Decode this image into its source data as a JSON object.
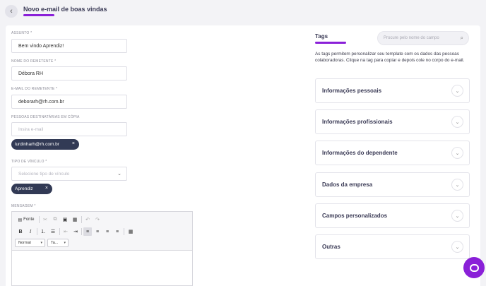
{
  "header": {
    "title": "Novo e-mail de boas vindas",
    "back_icon": "chevron-left-icon"
  },
  "form": {
    "assunto": {
      "label": "ASSUNTO *",
      "value": "Bem vindo Aprendiz!"
    },
    "nome_remetente": {
      "label": "NOME DO REMETENTE *",
      "value": "Débora RH"
    },
    "email_remetente": {
      "label": "E-MAIL DO REMETENTE *",
      "value": "deborarh@rh.com.br"
    },
    "copia": {
      "label": "PESSOAS DESTINATÁRIAS EM CÓPIA",
      "placeholder": "Insira e-mail",
      "chips": [
        "lurdinharh@rh.com.br"
      ]
    },
    "vinculo": {
      "label": "TIPO DE VÍNCULO *",
      "placeholder": "Selecione tipo de vínculo",
      "chips": [
        "Aprendiz"
      ]
    },
    "mensagem": {
      "label": "MENSAGEM *"
    }
  },
  "editor": {
    "source_label": "Fonte",
    "format_select": "Normal",
    "size_select": "Ta..."
  },
  "tags": {
    "title": "Tags",
    "search_placeholder": "Procure pelo nome do campo",
    "description": "As tags permitem personalizar seu template com os dados das pessoas colaboradoras. Clique na tag para copiar e depois cole no corpo do e-mail.",
    "sections": [
      {
        "label": "Informações pessoais"
      },
      {
        "label": "Informações profissionais"
      },
      {
        "label": "Informações do dependente"
      },
      {
        "label": "Dados da empresa"
      },
      {
        "label": "Campos personalizados"
      },
      {
        "label": "Outras"
      }
    ]
  },
  "colors": {
    "accent": "#8a20d8",
    "chip": "#323a55"
  }
}
